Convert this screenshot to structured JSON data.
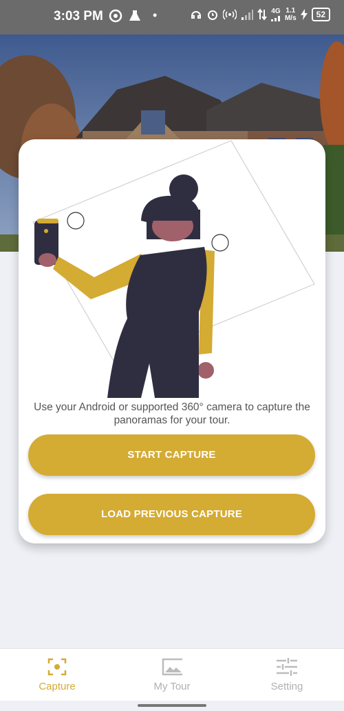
{
  "status_bar": {
    "time": "3:03 PM",
    "dot": "•",
    "network_type": "4G",
    "speed_value": "1.1",
    "speed_unit": "M/s",
    "battery": "52"
  },
  "hero_image": {
    "alt_icon": "house-photo"
  },
  "card": {
    "description": "Use your Android or supported 360° camera to capture the panoramas for your tour.",
    "start_button": "START CAPTURE",
    "load_button": "LOAD PREVIOUS CAPTURE"
  },
  "nav": {
    "items": [
      {
        "label": "Capture",
        "icon": "capture-icon",
        "active": true
      },
      {
        "label": "My Tour",
        "icon": "image-icon",
        "active": false
      },
      {
        "label": "Setting",
        "icon": "sliders-icon",
        "active": false
      }
    ]
  },
  "colors": {
    "accent": "#d4ab33",
    "status_bar": "#6b6b6b",
    "background": "#eef0f5",
    "figure_dark": "#2f2e41",
    "skin": "#a0616a"
  }
}
